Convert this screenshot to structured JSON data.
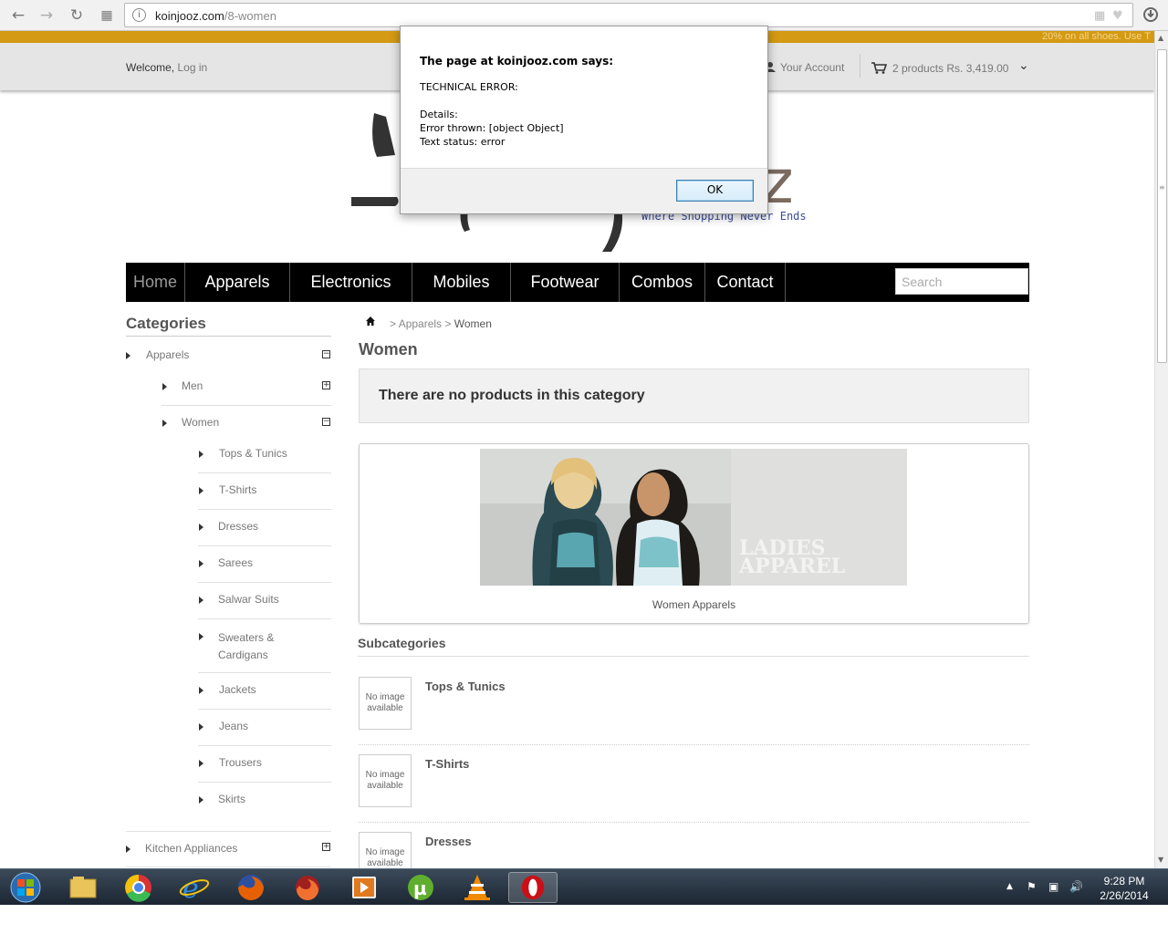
{
  "browser": {
    "url_host": "koinjooz.com",
    "url_path": "/8-women"
  },
  "site": {
    "promo_text": "20% on all shoes. Use T",
    "welcome": "Welcome,",
    "login": "Log in",
    "account": "Your Account",
    "cart": "2 products Rs. 3,419.00",
    "logo_letter": "z",
    "tagline": "Where Shopping Never Ends"
  },
  "menu": {
    "items": [
      "Home",
      "Apparels",
      "Electronics",
      "Mobiles",
      "Footwear",
      "Combos",
      "Contact"
    ],
    "search_placeholder": "Search"
  },
  "sidebar": {
    "title": "Categories",
    "items": [
      {
        "label": "Apparels",
        "level": 0,
        "toggle": "−"
      },
      {
        "label": "Men",
        "level": 1,
        "toggle": "+"
      },
      {
        "label": "Women",
        "level": 1,
        "toggle": "−"
      },
      {
        "label": "Tops & Tunics",
        "level": 2
      },
      {
        "label": "T-Shirts",
        "level": 2
      },
      {
        "label": "Dresses",
        "level": 2
      },
      {
        "label": "Sarees",
        "level": 2
      },
      {
        "label": "Salwar Suits",
        "level": 2
      },
      {
        "label": "Sweaters &",
        "label2": "Cardigans",
        "level": 2
      },
      {
        "label": "Jackets",
        "level": 2
      },
      {
        "label": "Jeans",
        "level": 2
      },
      {
        "label": "Trousers",
        "level": 2
      },
      {
        "label": "Skirts",
        "level": 2
      },
      {
        "label": "Kitchen Appliances",
        "level": 0,
        "toggle": "+"
      }
    ]
  },
  "main": {
    "breadcrumb": [
      ">",
      "Apparels",
      ">",
      "Women"
    ],
    "title": "Women",
    "notice": "There are no products in this category",
    "banner_text_1": "LADIES",
    "banner_text_2": "APPAREL",
    "banner_caption": "Women Apparels",
    "subcategories_title": "Subcategories",
    "no_image_1": "No image",
    "no_image_2": "available",
    "subcategories": [
      "Tops & Tunics",
      "T-Shirts",
      "Dresses"
    ]
  },
  "dialog": {
    "title": "The page at koinjooz.com says:",
    "line1": "TECHNICAL ERROR:",
    "line2": "Details:",
    "line3": "Error thrown: [object Object]",
    "line4": "Text status: error",
    "ok": "OK"
  },
  "taskbar": {
    "time": "9:28 PM",
    "date": "2/26/2014",
    "apps": [
      "explorer-icon",
      "chrome-icon",
      "ie-icon",
      "firefox-icon",
      "firefox-aurora-icon",
      "media-player-icon",
      "utorrent-icon",
      "vlc-icon",
      "opera-icon"
    ]
  },
  "colors": {
    "promo": "#d49a13",
    "menu_bg": "#000000",
    "tagline": "#3a4a9a"
  }
}
